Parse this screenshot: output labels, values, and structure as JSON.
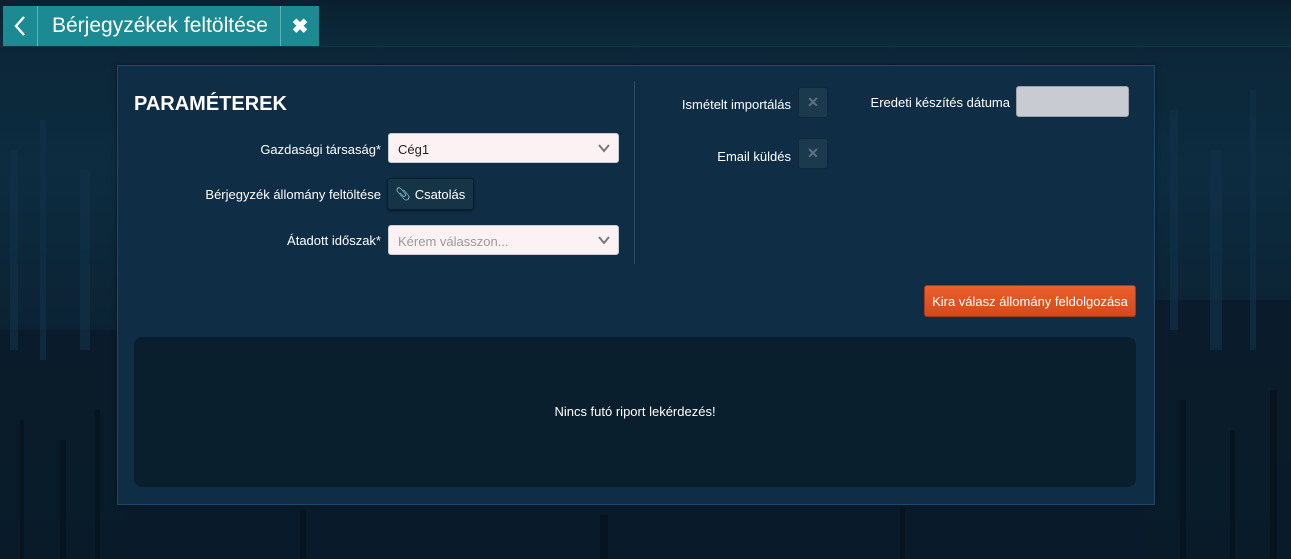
{
  "header": {
    "title": "Bérjegyzékek feltöltése",
    "back_icon": "chevron-left-icon",
    "close_icon": "close-icon"
  },
  "panel": {
    "heading": "PARAMÉTEREK",
    "company_label": "Gazdasági társaság*",
    "company_value": "Cég1",
    "upload_label": "Bérjegyzék állomány feltöltése",
    "attach_button": "Csatolás",
    "period_label": "Átadott időszak*",
    "period_placeholder": "Kérem válasszon...",
    "reimport_label": "Ismételt importálás",
    "email_label": "Email küldés",
    "creation_date_label": "Eredeti készítés dátuma",
    "creation_date_value": "",
    "process_button": "Kira válasz állomány feldolgozása",
    "report_message": "Nincs futó riport lekérdezés!"
  },
  "colors": {
    "accent_teal": "#1c8a92",
    "panel_bg": "#0f2d45",
    "primary_orange": "#e0531f"
  }
}
